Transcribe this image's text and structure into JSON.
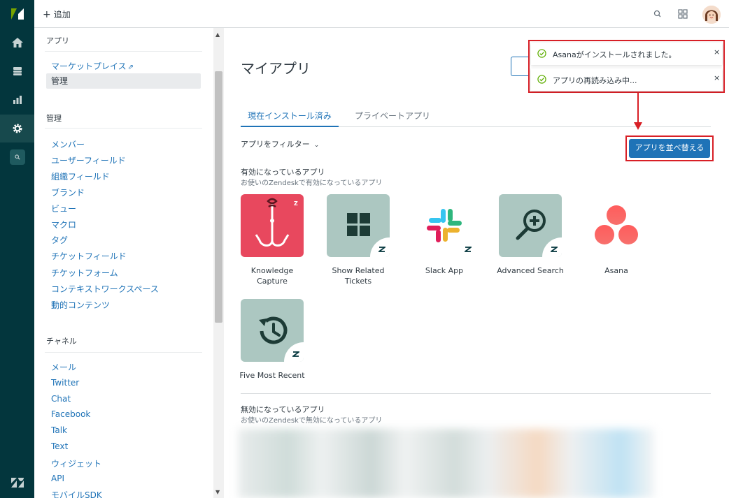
{
  "topbar": {
    "add_label": "追加"
  },
  "sidebar": {
    "apps_title": "アプリ",
    "apps_items": [
      {
        "label": "マーケットプレイス",
        "external": "⇗"
      },
      {
        "label": "管理"
      }
    ],
    "manage_title": "管理",
    "manage_items": [
      "メンバー",
      "ユーザーフィールド",
      "組織フィールド",
      "ブランド",
      "ビュー",
      "マクロ",
      "タグ",
      "チケットフィールド",
      "チケットフォーム",
      "コンテキストワークスペース",
      "動的コンテンツ"
    ],
    "channel_title": "チャネル",
    "channel_items": [
      "メール",
      "Twitter",
      "Chat",
      "Facebook",
      "Talk",
      "Text",
      "ウィジェット",
      "API",
      "モバイルSDK"
    ]
  },
  "main": {
    "title": "マイアプリ",
    "tabs": [
      {
        "label": "現在インストール済み"
      },
      {
        "label": "プライベートアプリ"
      }
    ],
    "filter_label": "アプリをフィルター",
    "sort_button": "アプリを並べ替える",
    "enabled_heading": "有効になっているアプリ",
    "enabled_sub": "お使いのZendeskで有効になっているアプリ",
    "apps": [
      {
        "name": "Knowledge\nCapture",
        "color": "#e8485e"
      },
      {
        "name": "Show Related\nTickets",
        "color": "#acc7c1"
      },
      {
        "name": "Slack App",
        "color": "#ffffff"
      },
      {
        "name": "Advanced Search",
        "color": "#acc7c1"
      },
      {
        "name": "Asana",
        "color": "#ffffff"
      },
      {
        "name": "Five Most Recent",
        "color": "#acc7c1"
      }
    ],
    "disabled_heading": "無効になっているアプリ",
    "disabled_sub": "お使いのZendeskで無効になっているアプリ"
  },
  "notifications": [
    {
      "message": "Asanaがインストールされました。",
      "close": "×"
    },
    {
      "message": "アプリの再読み込み中...",
      "close": "×"
    }
  ],
  "colors": {
    "rail": "#03363d",
    "link": "#1f73b7",
    "primary": "#1f73b7",
    "annotation": "#d81f26",
    "success": "#038153"
  }
}
